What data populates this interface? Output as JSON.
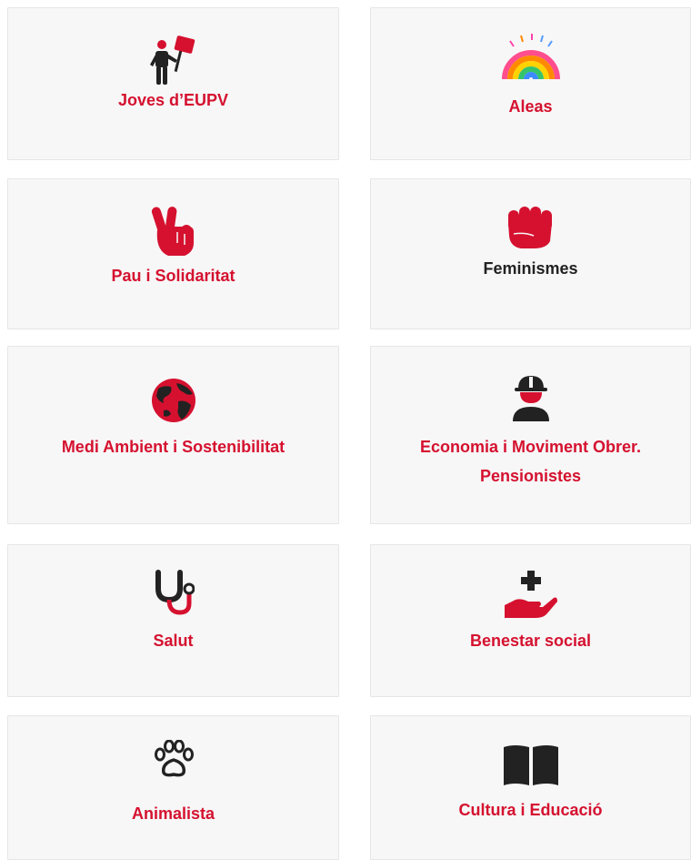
{
  "brand": {
    "accent": "#d5112f",
    "dark": "#222222",
    "card_bg": "#f7f7f7"
  },
  "cards": [
    {
      "id": "joves",
      "label": "Joves d’EUPV",
      "icon": "protester-icon",
      "label_color": "red"
    },
    {
      "id": "aleas",
      "label": "Aleas",
      "icon": "rainbow-icon",
      "label_color": "red"
    },
    {
      "id": "pau",
      "label": "Pau i Solidaritat",
      "icon": "peace-hand-icon",
      "label_color": "red"
    },
    {
      "id": "feminismes",
      "label": "Feminismes",
      "icon": "raised-fist-icon",
      "label_color": "dark"
    },
    {
      "id": "medi",
      "label": "Medi Ambient i Sostenibilitat",
      "icon": "globe-icon",
      "label_color": "red"
    },
    {
      "id": "economia",
      "label_line1": "Economia i Moviment Obrer.",
      "label_line2": "Pensionistes",
      "icon": "hard-hat-worker-icon",
      "label_color": "red"
    },
    {
      "id": "salut",
      "label": "Salut",
      "icon": "stethoscope-icon",
      "label_color": "red"
    },
    {
      "id": "benestar",
      "label": "Benestar social",
      "icon": "helping-hand-icon",
      "label_color": "red"
    },
    {
      "id": "animalista",
      "label": "Animalista",
      "icon": "paw-icon",
      "label_color": "red"
    },
    {
      "id": "cultura",
      "label": "Cultura i Educació",
      "icon": "open-book-icon",
      "label_color": "red"
    }
  ]
}
